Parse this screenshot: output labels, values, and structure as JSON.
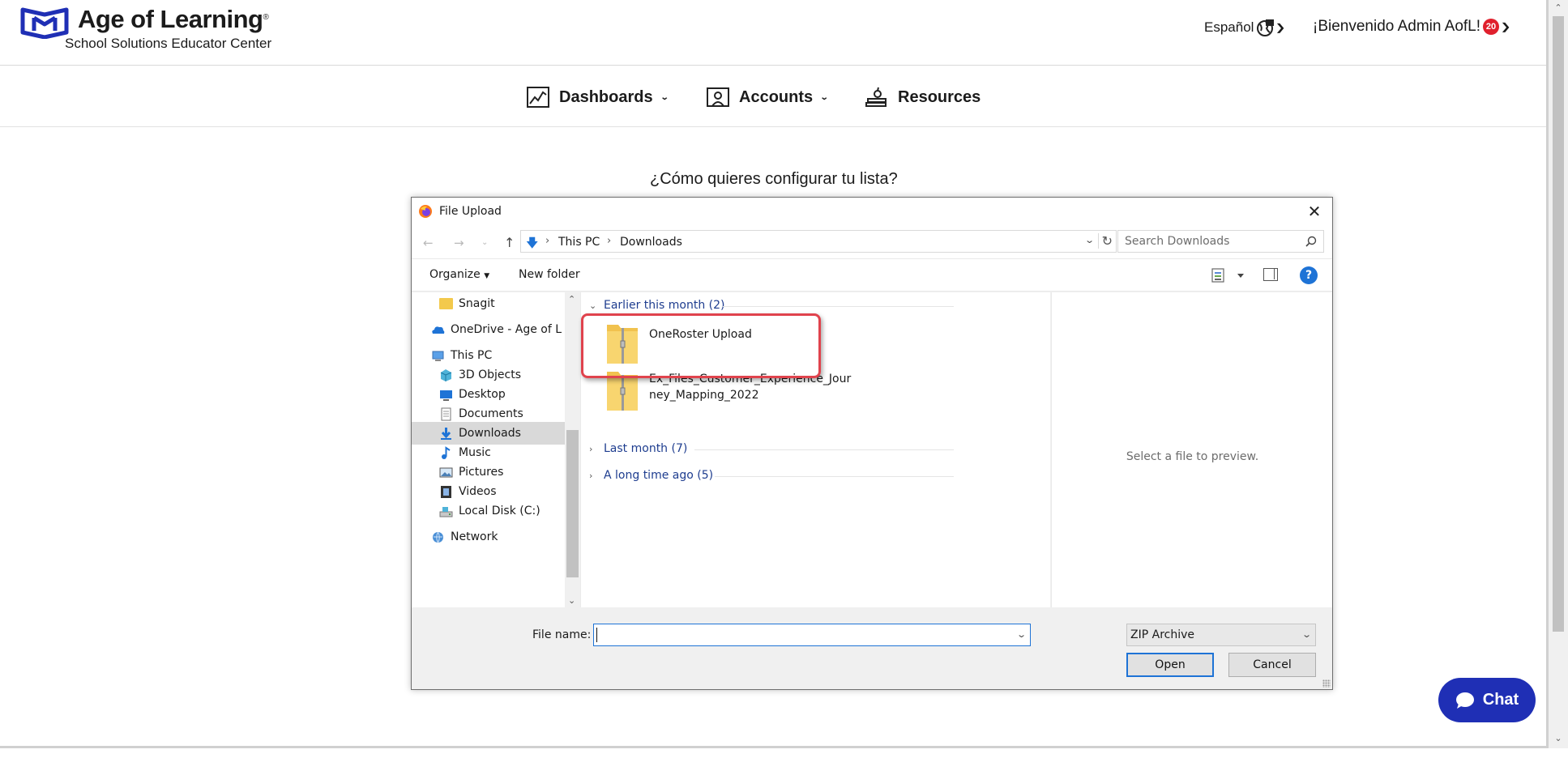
{
  "header": {
    "logo_title": "Age of Learning",
    "logo_trademark": "®",
    "logo_subtitle": "School Solutions Educator Center",
    "language_label": "Español",
    "welcome_text": "¡Bienvenido Admin AofL!",
    "notification_count": "20"
  },
  "nav": {
    "dashboards": "Dashboards",
    "accounts": "Accounts",
    "resources": "Resources"
  },
  "page": {
    "question": "¿Cómo quieres configurar tu lista?"
  },
  "dialog": {
    "title": "File Upload",
    "breadcrumb": [
      "This PC",
      "Downloads"
    ],
    "search_placeholder": "Search Downloads",
    "toolbar": {
      "organize": "Organize",
      "new_folder": "New folder"
    },
    "nav_pane": [
      {
        "label": "Snagit",
        "icon": "folder-icon"
      },
      {
        "label": "OneDrive - Age of L",
        "icon": "onedrive-icon"
      },
      {
        "label": "This PC",
        "icon": "this-pc-icon"
      },
      {
        "label": "3D Objects",
        "icon": "3d-objects-icon"
      },
      {
        "label": "Desktop",
        "icon": "desktop-icon"
      },
      {
        "label": "Documents",
        "icon": "documents-icon"
      },
      {
        "label": "Downloads",
        "icon": "downloads-icon",
        "selected": true
      },
      {
        "label": "Music",
        "icon": "music-icon"
      },
      {
        "label": "Pictures",
        "icon": "pictures-icon"
      },
      {
        "label": "Videos",
        "icon": "videos-icon"
      },
      {
        "label": "Local Disk (C:)",
        "icon": "local-disk-icon"
      },
      {
        "label": "Network",
        "icon": "network-icon"
      }
    ],
    "groups": [
      {
        "label": "Earlier this month (2)",
        "expanded": true
      },
      {
        "label": "Last month (7)",
        "expanded": false
      },
      {
        "label": "A long time ago (5)",
        "expanded": false
      }
    ],
    "files": [
      {
        "name": "OneRoster Upload",
        "icon": "zip-folder-icon",
        "highlighted": true
      },
      {
        "name_line1": "Ex_Files_Customer_Experience_Jour",
        "name_line2": "ney_Mapping_2022",
        "icon": "zip-folder-icon"
      }
    ],
    "preview_text": "Select a file to preview.",
    "filename_label": "File name:",
    "filename_value": "",
    "filetype_selected": "ZIP Archive",
    "open_label": "Open",
    "cancel_label": "Cancel"
  },
  "chat": {
    "label": "Chat"
  },
  "colors": {
    "brand_blue": "#1f2fb5",
    "highlight_red": "#e0434d",
    "notification_red": "#e0202d",
    "windows_accent": "#1e73d6"
  }
}
